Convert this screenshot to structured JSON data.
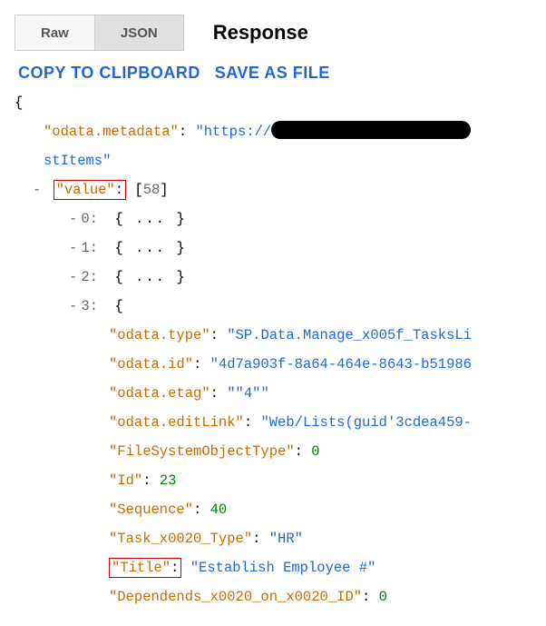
{
  "toolbar": {
    "raw_label": "Raw",
    "json_label": "JSON",
    "heading": "Response"
  },
  "actions": {
    "copy": "COPY TO CLIPBOARD",
    "save": "SAVE AS FILE"
  },
  "json": {
    "opening_brace": "{",
    "odata_metadata": {
      "key": "\"odata.metadata\"",
      "value_prefix": "\"https://",
      "value_line2": "stItems\""
    },
    "value_key": "\"value\"",
    "value_count": "58",
    "collapsed_label": "{ ... }",
    "indices": {
      "i0": "0:",
      "i1": "1:",
      "i2": "2:",
      "i3": "3:"
    },
    "item3": {
      "open_brace": "{",
      "odata_type": {
        "key": "\"odata.type\"",
        "value": "\"SP.Data.Manage_x005f_TasksLi"
      },
      "odata_id": {
        "key": "\"odata.id\"",
        "value": "\"4d7a903f-8a64-464e-8643-b51986"
      },
      "odata_etag": {
        "key": "\"odata.etag\"",
        "value": "\"\"4\"\""
      },
      "odata_editLink": {
        "key": "\"odata.editLink\"",
        "value": "\"Web/Lists(guid'3cdea459-"
      },
      "FileSystemObjectType": {
        "key": "\"FileSystemObjectType\"",
        "value": "0"
      },
      "Id": {
        "key": "\"Id\"",
        "value": "23"
      },
      "Sequence": {
        "key": "\"Sequence\"",
        "value": "40"
      },
      "Task_x0020_Type": {
        "key": "\"Task_x0020_Type\"",
        "value": "\"HR\""
      },
      "Title": {
        "key": "\"Title\"",
        "value": "\"Establish Employee #\""
      },
      "Dependends": {
        "key": "\"Dependends_x0020_on_x0020_ID\"",
        "value": "0"
      }
    }
  }
}
